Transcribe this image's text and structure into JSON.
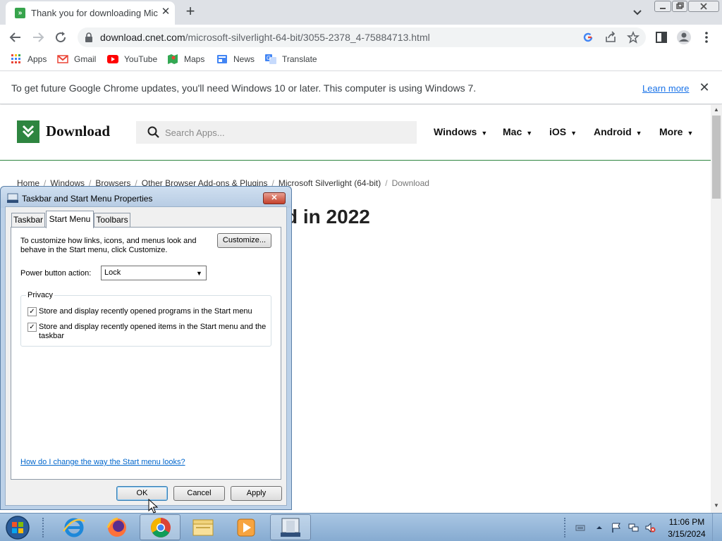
{
  "browser": {
    "tab_title": "Thank you for downloading Mic",
    "tab_favicon": "cnet-download-favicon",
    "url_domain": "download.cnet.com",
    "url_path": "/microsoft-silverlight-64-bit/3055-2378_4-75884713.html"
  },
  "bookmarks": [
    {
      "label": "Apps",
      "icon": "apps-grid-icon"
    },
    {
      "label": "Gmail",
      "icon": "gmail-icon"
    },
    {
      "label": "YouTube",
      "icon": "youtube-icon"
    },
    {
      "label": "Maps",
      "icon": "maps-icon"
    },
    {
      "label": "News",
      "icon": "news-icon"
    },
    {
      "label": "Translate",
      "icon": "translate-icon"
    }
  ],
  "infobar": {
    "message": "To get future Google Chrome updates, you'll need Windows 10 or later. This computer is using Windows 7.",
    "link": "Learn more"
  },
  "site": {
    "logo_text": "Download",
    "search_placeholder": "Search Apps...",
    "menu": [
      "Windows",
      "Mac",
      "iOS",
      "Android",
      "More"
    ],
    "breadcrumb": [
      "Home",
      "Windows",
      "Browsers",
      "Other Browser Add-ons & Plugins",
      "Microsoft Silverlight (64-bit)",
      "Download"
    ],
    "heading_visible": "d in 2022",
    "accent_color": "#2e8540"
  },
  "dialog": {
    "title": "Taskbar and Start Menu Properties",
    "tabs": [
      "Taskbar",
      "Start Menu",
      "Toolbars"
    ],
    "active_tab": "Start Menu",
    "description": "To customize how links, icons, and menus look and behave in the Start menu, click Customize.",
    "customize_button": "Customize...",
    "power_label": "Power button action:",
    "power_value": "Lock",
    "privacy_label": "Privacy",
    "checkbox1": "Store and display recently opened programs in the Start menu",
    "checkbox1_checked": true,
    "checkbox2": "Store and display recently opened items in the Start menu and the taskbar",
    "checkbox2_checked": true,
    "check_mark": "✓",
    "help_link": "How do I change the way the Start menu looks?",
    "ok": "OK",
    "cancel": "Cancel",
    "apply": "Apply"
  },
  "taskbar": {
    "apps": [
      "internet-explorer-icon",
      "firefox-icon",
      "chrome-icon",
      "file-explorer-icon",
      "media-player-icon",
      "taskbar-properties-icon"
    ],
    "time": "11:06 PM",
    "date": "3/15/2024"
  }
}
